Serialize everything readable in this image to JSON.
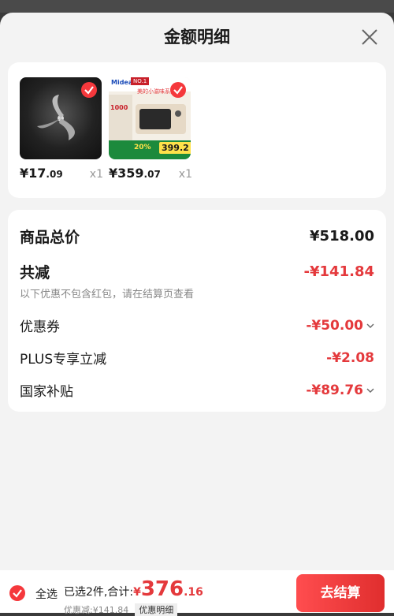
{
  "header": {
    "title": "金额明细",
    "close_icon": "close-icon"
  },
  "products": [
    {
      "price_int": "¥17",
      "price_dec": ".09",
      "qty": "x1",
      "thumb_icon": "blade-image"
    },
    {
      "price_int": "¥359",
      "price_dec": ".07",
      "qty": "x1",
      "thumb_icon": "microwave-image",
      "thumb_text": {
        "brand": "Midea",
        "badge": "NO.1",
        "title": "美的小滋味系列",
        "sub": "1000",
        "pct": "20%",
        "promo": "399.2"
      }
    }
  ],
  "prices": {
    "total_label": "商品总价",
    "total_value": "¥518.00",
    "reduce_label": "共减",
    "reduce_value": "-¥141.84",
    "note": "以下优惠不包含红包，请在结算页查看",
    "coupon_label": "优惠券",
    "coupon_value": "-¥50.00",
    "plus_label": "PLUS专享立减",
    "plus_value": "-¥2.08",
    "subsidy_label": "国家补贴",
    "subsidy_value": "-¥89.76"
  },
  "footer": {
    "select_all": "全选",
    "selected": "已选2件,合计:",
    "yen": "¥",
    "total_int": "376",
    "total_dec": ".16",
    "discount": "优惠减:¥141.84",
    "detail_link": "优惠明细",
    "checkout": "去结算"
  },
  "colors": {
    "accent": "#e4393c",
    "check": "#f5383c"
  }
}
